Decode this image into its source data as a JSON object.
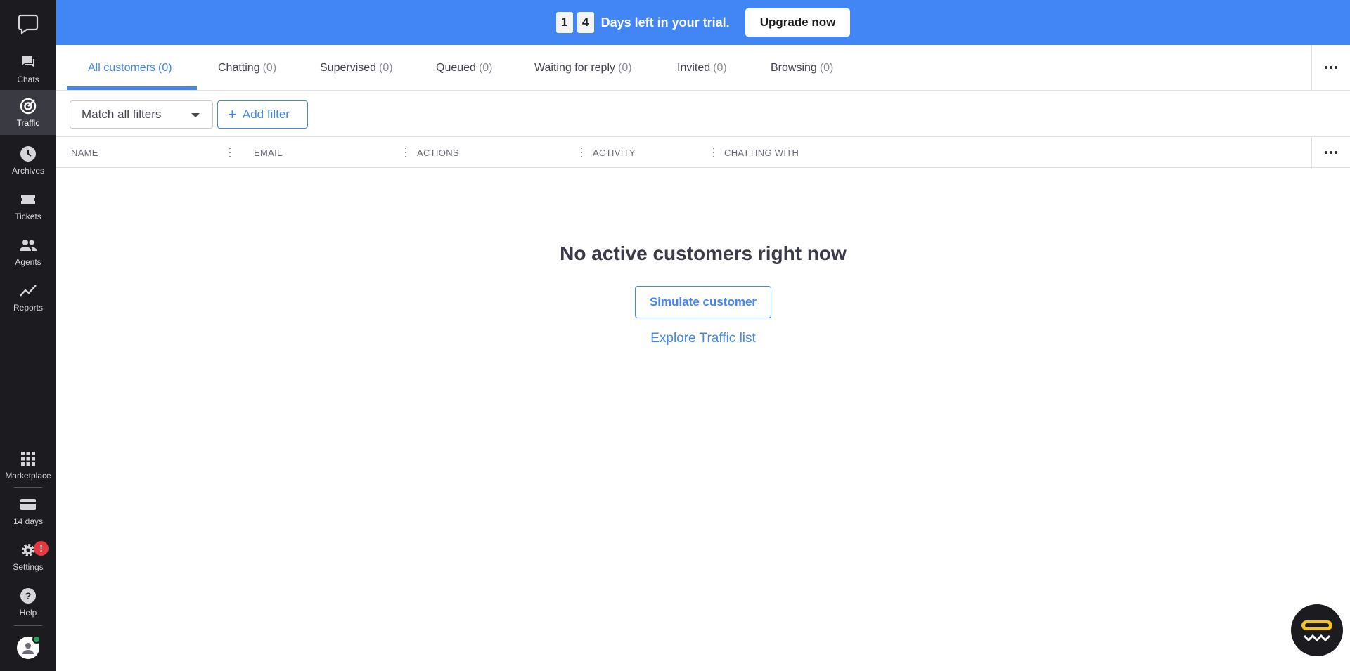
{
  "sidebar": {
    "items": [
      {
        "label": "Chats",
        "icon": "chat-bubble-icon"
      },
      {
        "label": "Traffic",
        "icon": "traffic-target-icon"
      },
      {
        "label": "Archives",
        "icon": "clock-icon"
      },
      {
        "label": "Tickets",
        "icon": "ticket-icon"
      },
      {
        "label": "Agents",
        "icon": "agents-icon"
      },
      {
        "label": "Reports",
        "icon": "chart-line-icon"
      },
      {
        "label": "Marketplace",
        "icon": "grid-icon"
      },
      {
        "label": "14 days",
        "icon": "card-icon"
      },
      {
        "label": "Settings",
        "icon": "gear-icon"
      },
      {
        "label": "Help",
        "icon": "help-icon"
      }
    ],
    "settings_badge": "!"
  },
  "trial": {
    "digit1": "1",
    "digit2": "4",
    "text": "Days left in your trial.",
    "upgrade_label": "Upgrade now"
  },
  "tabs": [
    {
      "label": "All customers",
      "count": "(0)"
    },
    {
      "label": "Chatting",
      "count": "(0)"
    },
    {
      "label": "Supervised",
      "count": "(0)"
    },
    {
      "label": "Queued",
      "count": "(0)"
    },
    {
      "label": "Waiting for reply",
      "count": "(0)"
    },
    {
      "label": "Invited",
      "count": "(0)"
    },
    {
      "label": "Browsing",
      "count": "(0)"
    }
  ],
  "filters": {
    "match_select": "Match all filters",
    "add_filter_label": "Add filter"
  },
  "table": {
    "columns": [
      "NAME",
      "EMAIL",
      "ACTIONS",
      "ACTIVITY",
      "CHATTING WITH"
    ]
  },
  "empty_state": {
    "title": "No active customers right now",
    "simulate_label": "Simulate customer",
    "explore_label": "Explore Traffic list"
  },
  "colors": {
    "accent": "#4285f4",
    "sidebar_bg": "#1b1b20",
    "badge_red": "#e5393f",
    "online_green": "#26a65b"
  }
}
